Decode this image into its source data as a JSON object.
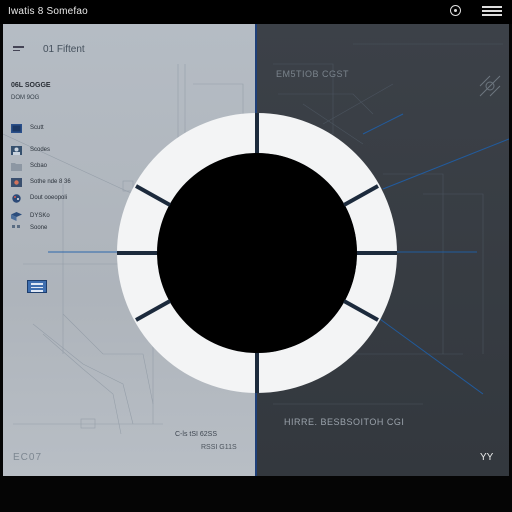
{
  "window": {
    "title": "Iwatis 8 Somefao",
    "controls": [
      "record-icon",
      "menu-lines-icon"
    ]
  },
  "left_panel": {
    "title": "01 Fiftent",
    "section_header": "06L SOGGE",
    "section_subtitle": "DOM 9OG",
    "items": [
      {
        "icon": "blue-square-icon",
        "label": "Scutt"
      },
      {
        "icon": "avatar-icon",
        "label": "Scodes"
      },
      {
        "icon": "folder-icon",
        "label": "Scbao"
      },
      {
        "icon": "settings-icon",
        "label": "Sothe nde 8 36"
      },
      {
        "icon": "palette-icon",
        "label": "Dout ooeopoli"
      },
      {
        "icon": "cube-icon",
        "label": "DYSKo"
      },
      {
        "icon": "grid-icon",
        "label": "Soone"
      }
    ],
    "bottom_label": "EC07",
    "mid_labels": [
      "C-ls tSI 62SS",
      "RSSI G11S"
    ]
  },
  "right_panel": {
    "title": "EM5TIOB CGST",
    "bottom_label": "HIRRE. BESBSOITOH CGI",
    "corner_mark": "YY"
  },
  "colors": {
    "left_bg": "#b2b9c1",
    "right_bg": "#383d44",
    "accent_blue": "#1e4a8a",
    "ring": "#f4f5f6",
    "center": "#000000"
  }
}
